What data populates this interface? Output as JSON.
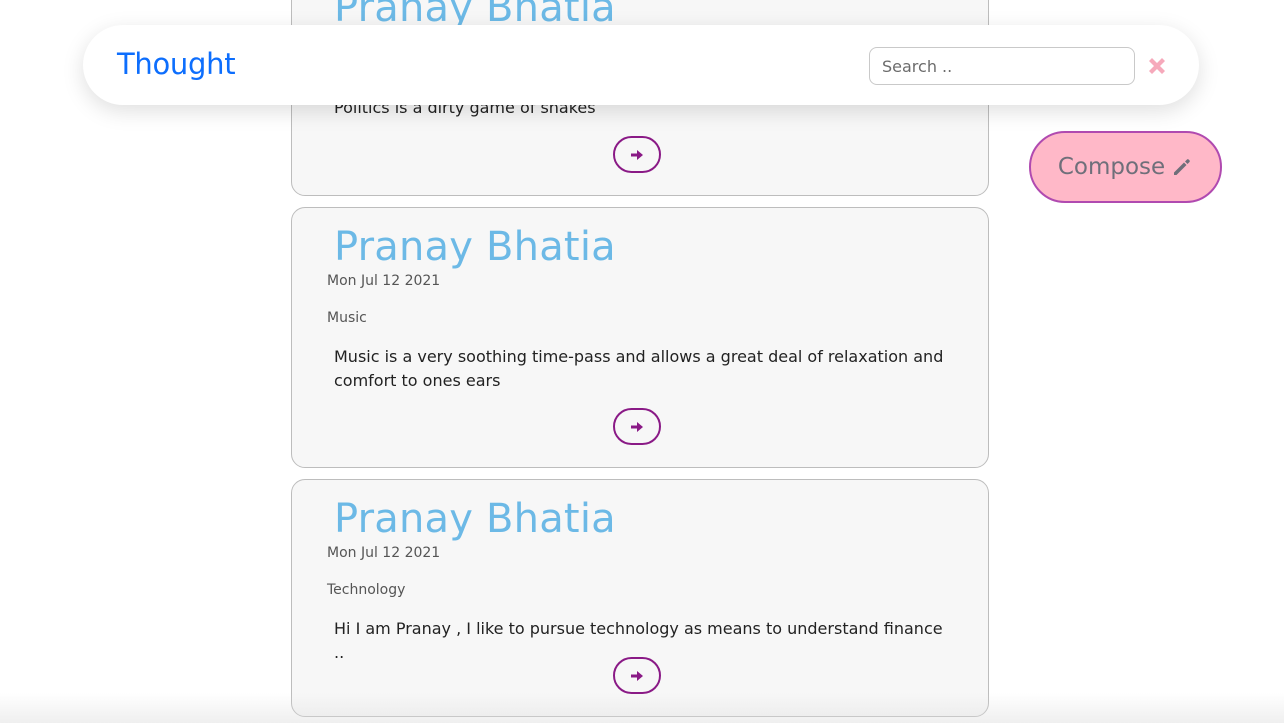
{
  "navbar": {
    "brand": "Thought",
    "search_placeholder": "Search ..",
    "close_icon": "close-x-icon",
    "brand_color": "#0d6efd",
    "close_color": "#f6a9bb"
  },
  "compose": {
    "label": "Compose",
    "icon": "pencil-icon",
    "bg_color": "#ffb8c8",
    "border_color": "#b04ab0"
  },
  "posts": [
    {
      "author": "Pranay Bhatia",
      "date": "",
      "category": "",
      "body": "Politics is a dirty game of snakes",
      "action_icon": "arrow-right-icon"
    },
    {
      "author": "Pranay Bhatia",
      "date": "Mon Jul 12 2021",
      "category": "Music",
      "body": "Music is a very soothing time-pass and allows a great deal of relaxation and comfort to ones ears",
      "action_icon": "arrow-right-icon"
    },
    {
      "author": "Pranay Bhatia",
      "date": "Mon Jul 12 2021",
      "category": "Technology",
      "body": "Hi I am Pranay , I like to pursue technology as means to understand finance ..",
      "action_icon": "arrow-right-icon"
    }
  ],
  "colors": {
    "author": "#6cb9e6",
    "arrow_button": "#8a1a86",
    "card_bg": "#f7f7f7"
  }
}
